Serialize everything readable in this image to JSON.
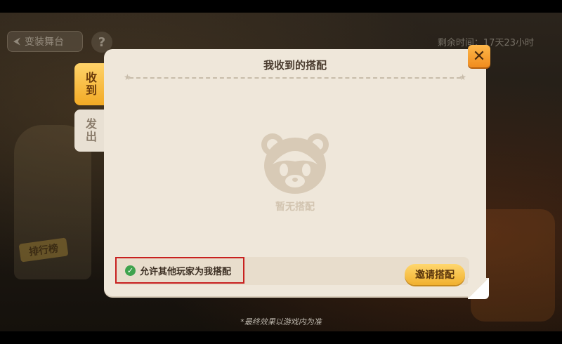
{
  "background": {
    "back_label": "变装舞台",
    "help_glyph": "?",
    "timer_text": "剩余时间：17天23小时",
    "banner_text": "排行榜"
  },
  "tabs": {
    "received": "收到",
    "sent": "发出"
  },
  "dialog": {
    "title": "我收到的搭配",
    "close_glyph": "✕",
    "empty_text": "暂无搭配",
    "allow_label": "允许其他玩家为我搭配",
    "invite_button": "邀请搭配"
  },
  "footer_note": "*最终效果以游戏内为准",
  "colors": {
    "accent_orange": "#f08c1e",
    "check_green": "#3fa34d",
    "highlight_red": "#c8201f",
    "panel": "#efe7da"
  }
}
